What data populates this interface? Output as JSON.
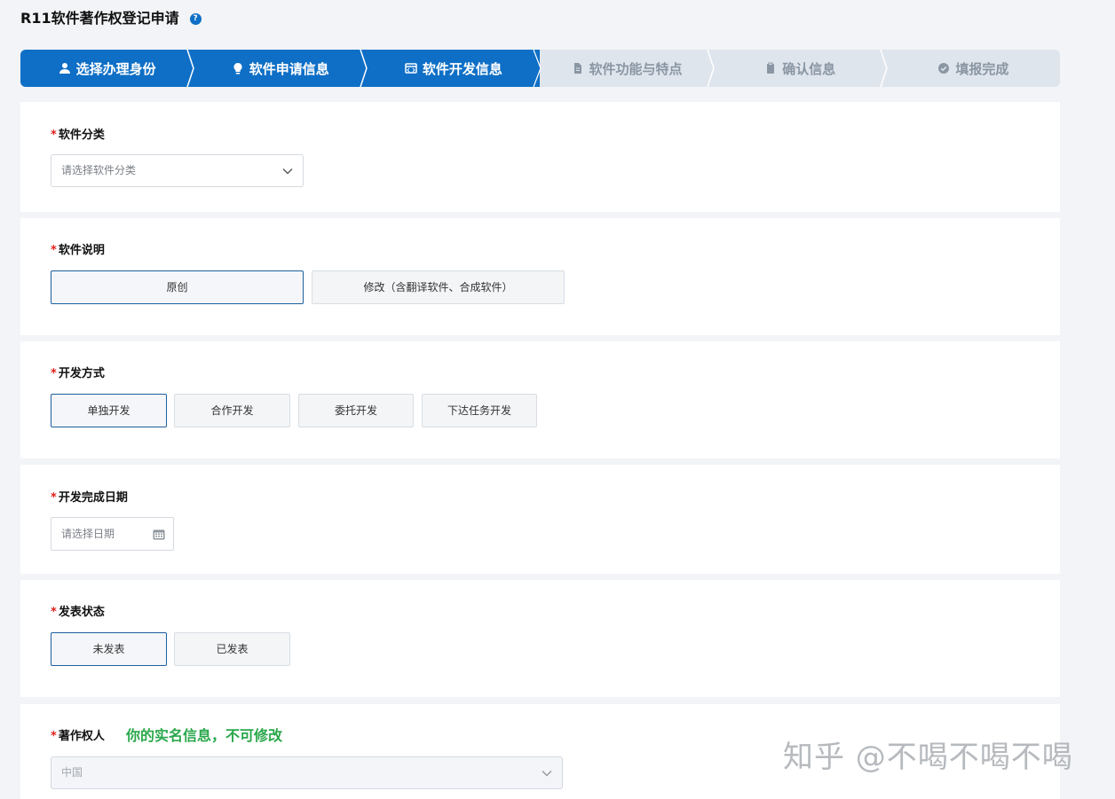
{
  "page": {
    "title": "R11软件著作权登记申请",
    "help_icon": "question-circle-icon"
  },
  "colors": {
    "accent": "#0f6fc6",
    "step_inactive_bg": "#dfe5ec",
    "required": "#e0201b",
    "note_green": "#29a74a"
  },
  "steps": [
    {
      "label": "选择办理身份",
      "icon": "user-icon",
      "state": "done"
    },
    {
      "label": "软件申请信息",
      "icon": "lightbulb-icon",
      "state": "done"
    },
    {
      "label": "软件开发信息",
      "icon": "code-window-icon",
      "state": "current"
    },
    {
      "label": "软件功能与特点",
      "icon": "document-icon",
      "state": "pending"
    },
    {
      "label": "确认信息",
      "icon": "clipboard-icon",
      "state": "pending"
    },
    {
      "label": "填报完成",
      "icon": "check-circle-icon",
      "state": "pending"
    }
  ],
  "form": {
    "required_mark": "*",
    "category": {
      "label": "软件分类",
      "placeholder": "请选择软件分类"
    },
    "description": {
      "label": "软件说明",
      "options": [
        "原创",
        "修改（含翻译软件、合成软件）"
      ],
      "selected": "原创"
    },
    "dev_method": {
      "label": "开发方式",
      "options": [
        "单独开发",
        "合作开发",
        "委托开发",
        "下达任务开发"
      ],
      "selected": "单独开发"
    },
    "completion_date": {
      "label": "开发完成日期",
      "placeholder": "请选择日期"
    },
    "publish_status": {
      "label": "发表状态",
      "options": [
        "未发表",
        "已发表"
      ],
      "selected": "未发表"
    },
    "copyright_owner": {
      "label": "著作权人",
      "note": "你的实名信息，不可修改",
      "value": "中国"
    }
  },
  "watermark": "知乎 @不喝不喝不喝"
}
